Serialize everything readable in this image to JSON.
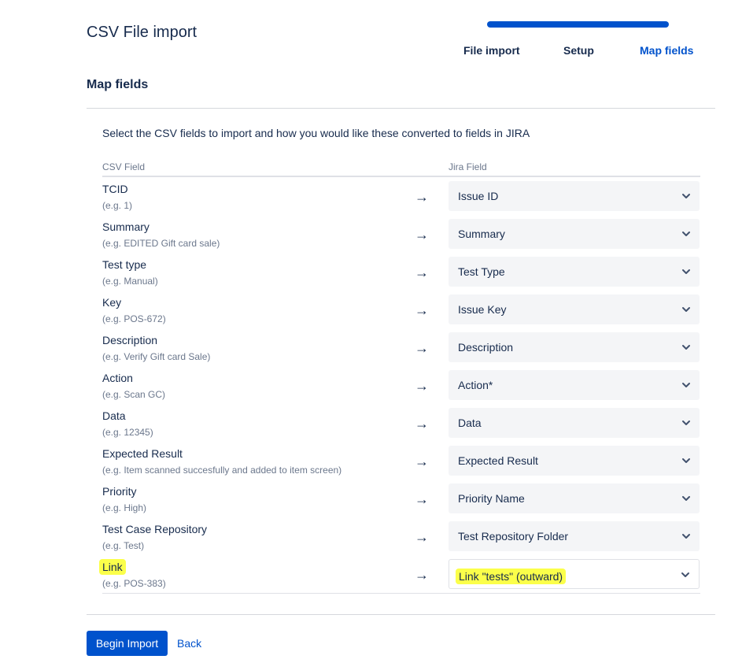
{
  "page": {
    "title": "CSV File import",
    "steps": [
      {
        "label": "File import",
        "active": false
      },
      {
        "label": "Setup",
        "active": false
      },
      {
        "label": "Map fields",
        "active": true
      }
    ],
    "progress": 1.0
  },
  "section": {
    "title": "Map fields",
    "instructions": "Select the CSV fields to import and how you would like these converted to fields in JIRA"
  },
  "table": {
    "headers": {
      "csv": "CSV Field",
      "jira": "Jira Field"
    },
    "arrow": "→",
    "rows": [
      {
        "csv_field": "TCID",
        "example": "(e.g. 1)",
        "jira_field": "Issue ID"
      },
      {
        "csv_field": "Summary",
        "example": "(e.g. EDITED Gift card sale)",
        "jira_field": "Summary"
      },
      {
        "csv_field": "Test type",
        "example": "(e.g. Manual)",
        "jira_field": "Test Type"
      },
      {
        "csv_field": "Key",
        "example": "(e.g. POS-672)",
        "jira_field": "Issue Key"
      },
      {
        "csv_field": "Description",
        "example": "(e.g. Verify Gift card Sale)",
        "jira_field": "Description"
      },
      {
        "csv_field": "Action",
        "example": "(e.g. Scan GC)",
        "jira_field": "Action*"
      },
      {
        "csv_field": "Data",
        "example": "(e.g. 12345)",
        "jira_field": "Data"
      },
      {
        "csv_field": "Expected Result",
        "example": "(e.g. Item scanned succesfully and added to item screen)",
        "jira_field": "Expected Result"
      },
      {
        "csv_field": "Priority",
        "example": "(e.g. High)",
        "jira_field": "Priority Name"
      },
      {
        "csv_field": "Test Case Repository",
        "example": "(e.g. Test)",
        "jira_field": "Test Repository Folder"
      },
      {
        "csv_field": "Link",
        "example": "(e.g. POS-383)",
        "jira_field": "Link \"tests\" (outward)",
        "highlighted": true,
        "focused": true
      }
    ]
  },
  "buttons": {
    "begin_import": "Begin Import",
    "back": "Back"
  },
  "colors": {
    "accent": "#0052cc",
    "highlight": "#fbff4a",
    "select_bg": "#f4f5f7"
  },
  "icons": {
    "select": "chevron-down-icon"
  }
}
